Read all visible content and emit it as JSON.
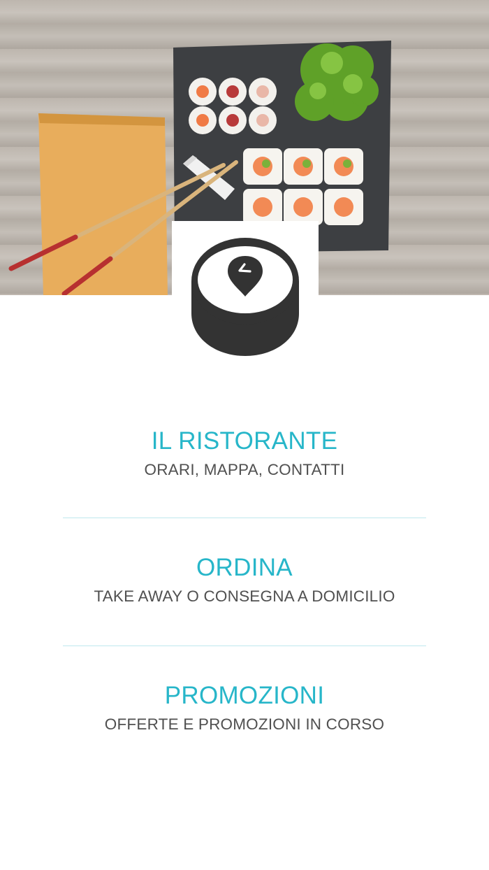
{
  "hero": {
    "image": "sushi-platter-photo"
  },
  "logo": {
    "icon": "sushi-roll-location-pin-icon"
  },
  "menu": {
    "items": [
      {
        "title": "IL RISTORANTE",
        "subtitle": "ORARI, MAPPA, CONTATTI"
      },
      {
        "title": "ORDINA",
        "subtitle": "TAKE AWAY O CONSEGNA A DOMICILIO"
      },
      {
        "title": "PROMOZIONI",
        "subtitle": "OFFERTE E PROMOZIONI IN CORSO"
      }
    ]
  },
  "colors": {
    "accent": "#27b6c9",
    "subtitle": "#505050",
    "divider": "#bfe8ee",
    "logo": "#333333"
  }
}
